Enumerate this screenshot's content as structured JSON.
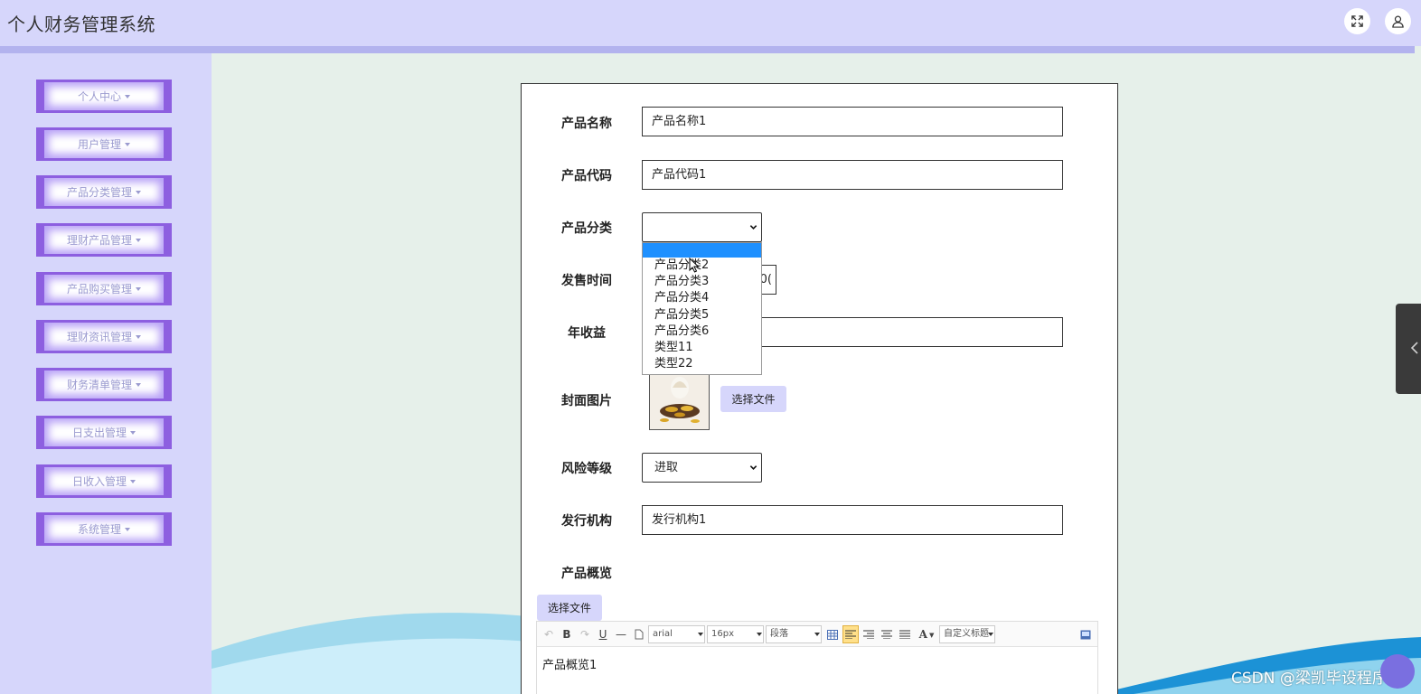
{
  "app": {
    "title": "个人财务管理系统"
  },
  "header": {
    "fullscreen_icon": "expand-arrows-icon",
    "user_icon": "user-icon"
  },
  "sidebar": {
    "items": [
      {
        "label": "个人中心"
      },
      {
        "label": "用户管理"
      },
      {
        "label": "产品分类管理"
      },
      {
        "label": "理财产品管理"
      },
      {
        "label": "产品购买管理"
      },
      {
        "label": "理财资讯管理"
      },
      {
        "label": "财务清单管理"
      },
      {
        "label": "日支出管理"
      },
      {
        "label": "日收入管理"
      },
      {
        "label": "系统管理"
      }
    ]
  },
  "form": {
    "product_name": {
      "label": "产品名称",
      "value": "产品名称1"
    },
    "product_code": {
      "label": "产品代码",
      "value": "产品代码1"
    },
    "category": {
      "label": "产品分类",
      "value": "",
      "options": [
        "",
        "产品分类2",
        "产品分类3",
        "产品分类4",
        "产品分类5",
        "产品分类6",
        "类型11",
        "类型22"
      ]
    },
    "sale_time": {
      "label": "发售时间",
      "value_fragment": "0("
    },
    "annual_yield": {
      "label": "年收益",
      "value": ""
    },
    "cover": {
      "label": "封面图片",
      "button": "选择文件"
    },
    "risk_level": {
      "label": "风险等级",
      "value": "进取"
    },
    "issuer": {
      "label": "发行机构",
      "value": "发行机构1"
    },
    "overview": {
      "label": "产品概览",
      "file_button": "选择文件",
      "font_family": "arial",
      "font_size": "16px",
      "paragraph": "段落",
      "custom_title": "自定义标题",
      "content": "产品概览1"
    }
  },
  "watermark": "CSDN @梁凯毕设程序",
  "colors": {
    "header_bg": "#d6d6fb",
    "menu_border": "#8d5fe0",
    "page_bg": "#e6f0ea",
    "dropdown_highlight": "#1e90ff"
  }
}
